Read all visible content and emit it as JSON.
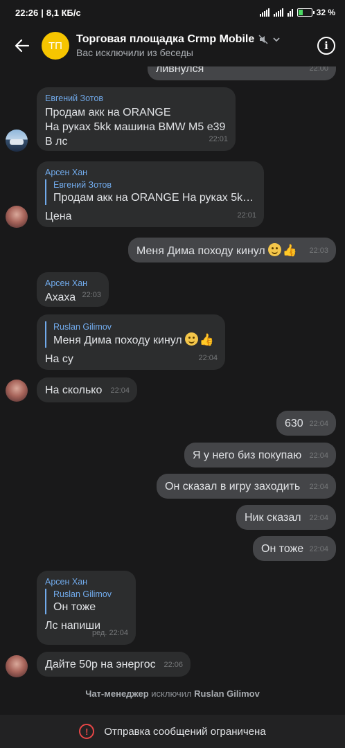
{
  "status": {
    "time": "22:26",
    "speed": "8,1 КБ/с",
    "battery": "32 %",
    "battery_level": 0.32
  },
  "header": {
    "avatar_initials": "ТП",
    "title": "Торговая площадка Crmp Mobile",
    "subtitle": "Вас исключили из беседы"
  },
  "messages": [
    {
      "text": "ливнулся",
      "time": "22:00"
    },
    {
      "sender": "Евгений Зотов",
      "lines": [
        "Продам акк на ORANGE",
        "На руках 5kk машина BMW M5 e39",
        "В лс"
      ],
      "time": "22:01"
    },
    {
      "sender": "Арсен Хан",
      "quote_name": "Евгений Зотов",
      "quote_text": "Продам акк на ORANGE На руках 5kk м...",
      "text": "Цена",
      "time": "22:01"
    },
    {
      "text": "Меня Дима походу кинул",
      "time": "22:03"
    },
    {
      "sender": "Арсен Хан",
      "text": "Ахаха",
      "time": "22:03"
    },
    {
      "quote_name": "Ruslan Gilimov",
      "quote_text": "Меня Дима походу кинул",
      "text": "На су",
      "time": "22:04"
    },
    {
      "text": "На сколько",
      "time": "22:04"
    },
    {
      "text": "630",
      "time": "22:04"
    },
    {
      "text": "Я у него биз покупаю",
      "time": "22:04"
    },
    {
      "text": "Он сказал в игру заходить",
      "time": "22:04"
    },
    {
      "text": "Ник сказал",
      "time": "22:04"
    },
    {
      "text": "Он тоже",
      "time": "22:04"
    },
    {
      "sender": "Арсен Хан",
      "quote_name": "Ruslan Gilimov",
      "quote_text": "Он тоже",
      "text": "Лс напиши",
      "time": "ред. 22:04"
    },
    {
      "text": "Дайте 50р на энергос",
      "time": "22:06"
    }
  ],
  "service": {
    "actor": "Чат-менеджер",
    "action": "исключил",
    "target": "Ruslan Gilimov"
  },
  "footer": {
    "notice": "Отправка сообщений ограничена"
  },
  "icons": {
    "back": "back-arrow-icon",
    "mute": "mute-icon",
    "info": "info-icon",
    "warning": "warning-icon"
  },
  "colors": {
    "background": "#19191a",
    "incoming": "#2c2d2e",
    "outgoing": "#444548",
    "accent": "#71aaeb",
    "avatar": "#f6c500",
    "warning": "#e64646"
  }
}
